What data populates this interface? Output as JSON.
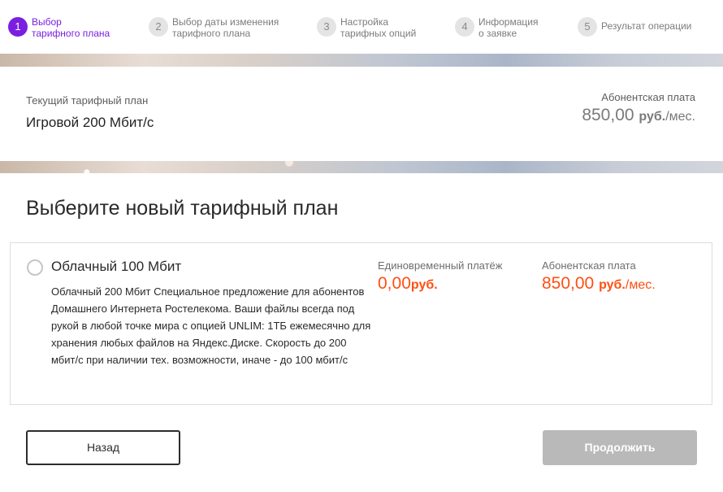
{
  "stepper": {
    "steps": [
      {
        "num": "1",
        "label": "Выбор\nтарифного плана",
        "active": true
      },
      {
        "num": "2",
        "label": "Выбор даты изменения\nтарифного плана",
        "active": false
      },
      {
        "num": "3",
        "label": "Настройка\nтарифных опций",
        "active": false
      },
      {
        "num": "4",
        "label": "Информация\nо заявке",
        "active": false
      },
      {
        "num": "5",
        "label": "Результат операции",
        "active": false
      }
    ]
  },
  "current_plan": {
    "label": "Текущий тарифный план",
    "name": "Игровой 200 Мбит/с",
    "fee_label": "Абонентская плата",
    "fee_amount": "850,00",
    "fee_currency": "руб.",
    "fee_period": "/мес."
  },
  "main": {
    "title": "Выберите новый тарифный план",
    "plan": {
      "name": "Облачный 100 Мбит",
      "description": "Облачный 200 Мбит Специальное предложение для абонентов Домашнего Интернета Ростелекома. Ваши файлы всегда под рукой в любой точке мира с опцией UNLIM: 1ТБ ежемесячно для хранения любых файлов на Яндекс.Диске. Скорость до 200 мбит/с при наличии тех. возможности, иначе - до 100 мбит/с",
      "onetime_label": "Единовременный платёж",
      "onetime_amount": "0,00",
      "onetime_currency": "руб.",
      "monthly_label": "Абонентская плата",
      "monthly_amount": "850,00",
      "monthly_currency": "руб.",
      "monthly_period": "/мес."
    },
    "back_label": "Назад",
    "continue_label": "Продолжить"
  },
  "colors": {
    "accent": "#7a1fe0",
    "price": "#ff4f12",
    "disabled_button": "#b9b9b9"
  }
}
